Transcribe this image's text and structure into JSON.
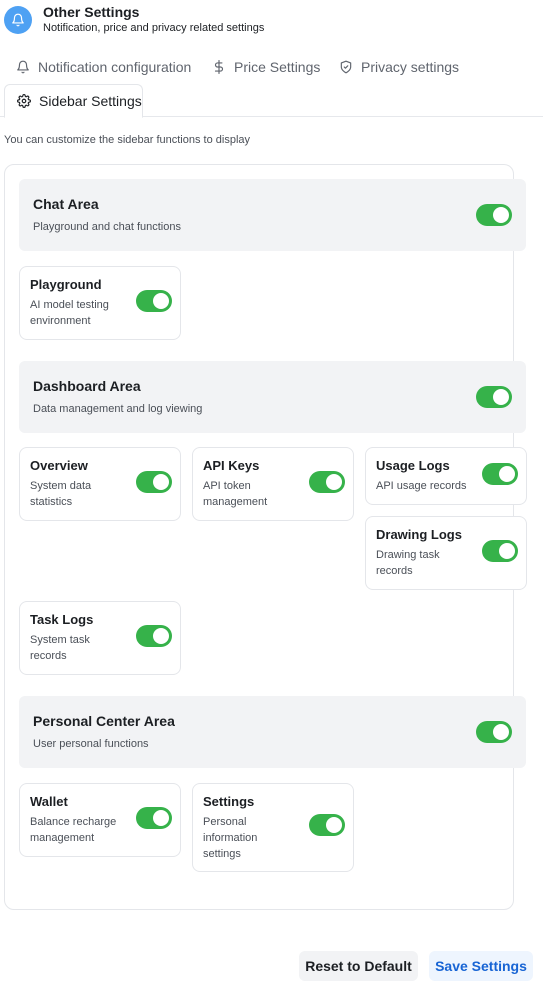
{
  "header": {
    "title": "Other Settings",
    "subtitle": "Notification, price and privacy related settings",
    "icon": "bell-icon",
    "icon_bg": "#4ea1f3"
  },
  "tabs": [
    {
      "label": "Notification configuration",
      "icon": "bell-icon",
      "active": false
    },
    {
      "label": "Price Settings",
      "icon": "dollar-icon",
      "active": false
    },
    {
      "label": "Privacy settings",
      "icon": "shield-icon",
      "active": false
    },
    {
      "label": "Sidebar Settings",
      "icon": "gear-icon",
      "active": true
    }
  ],
  "description": "You can customize the sidebar functions to display",
  "areas": [
    {
      "title": "Chat Area",
      "description": "Playground and chat functions",
      "enabled": true,
      "items": [
        {
          "title": "Playground",
          "description": "AI model testing environment",
          "enabled": true
        }
      ]
    },
    {
      "title": "Dashboard Area",
      "description": "Data management and log viewing",
      "enabled": true,
      "items": [
        {
          "title": "Overview",
          "description": "System data statistics",
          "enabled": true
        },
        {
          "title": "API Keys",
          "description": "API token management",
          "enabled": true
        },
        {
          "title": "Usage Logs",
          "description": "API usage records",
          "enabled": true
        },
        {
          "title": "Drawing Logs",
          "description": "Drawing task records",
          "enabled": true
        },
        {
          "title": "Task Logs",
          "description": "System task records",
          "enabled": true
        }
      ]
    },
    {
      "title": "Personal Center Area",
      "description": "User personal functions",
      "enabled": true,
      "items": [
        {
          "title": "Wallet",
          "description": "Balance recharge management",
          "enabled": true
        },
        {
          "title": "Settings",
          "description": "Personal information settings",
          "enabled": true
        }
      ]
    }
  ],
  "buttons": {
    "reset": "Reset to Default",
    "save": "Save Settings"
  },
  "colors": {
    "toggle_on": "#36b24a",
    "area_bg": "#f2f3f5",
    "primary_text": "#1764d4"
  }
}
